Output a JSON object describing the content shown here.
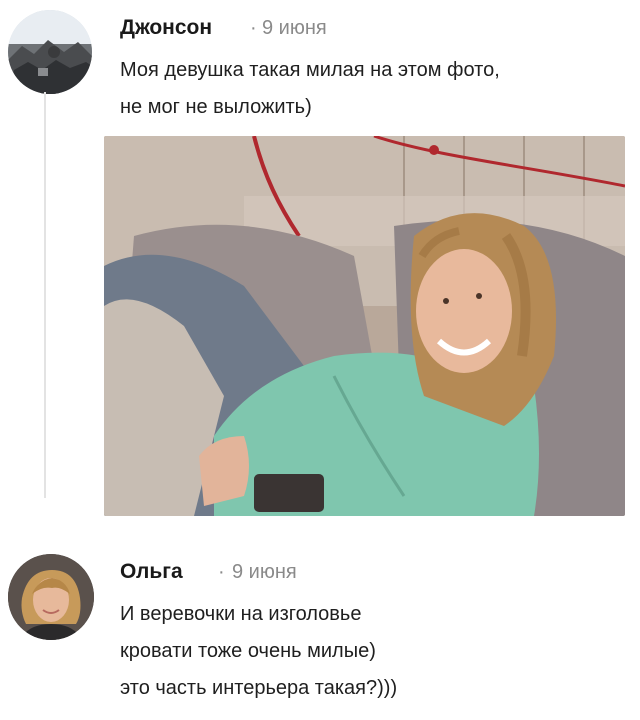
{
  "comments": [
    {
      "author": "Джонсон",
      "separator": "·",
      "date": "9 июня",
      "text": "Моя девушка такая милая на этом фото,\nне мог не выложить)"
    },
    {
      "author": "Ольга",
      "separator": "·",
      "date": "9 июня",
      "text": "И веревочки на изголовье\nкровати тоже очень милые)\nэто часть интерьера такая?)))"
    }
  ],
  "colors": {
    "author_text": "#1a1a1a",
    "meta_text": "#8a8a8a",
    "thread_line": "#e3e3e3"
  },
  "icons": [
    "avatar-jonson",
    "avatar-olga",
    "attached-photo"
  ]
}
